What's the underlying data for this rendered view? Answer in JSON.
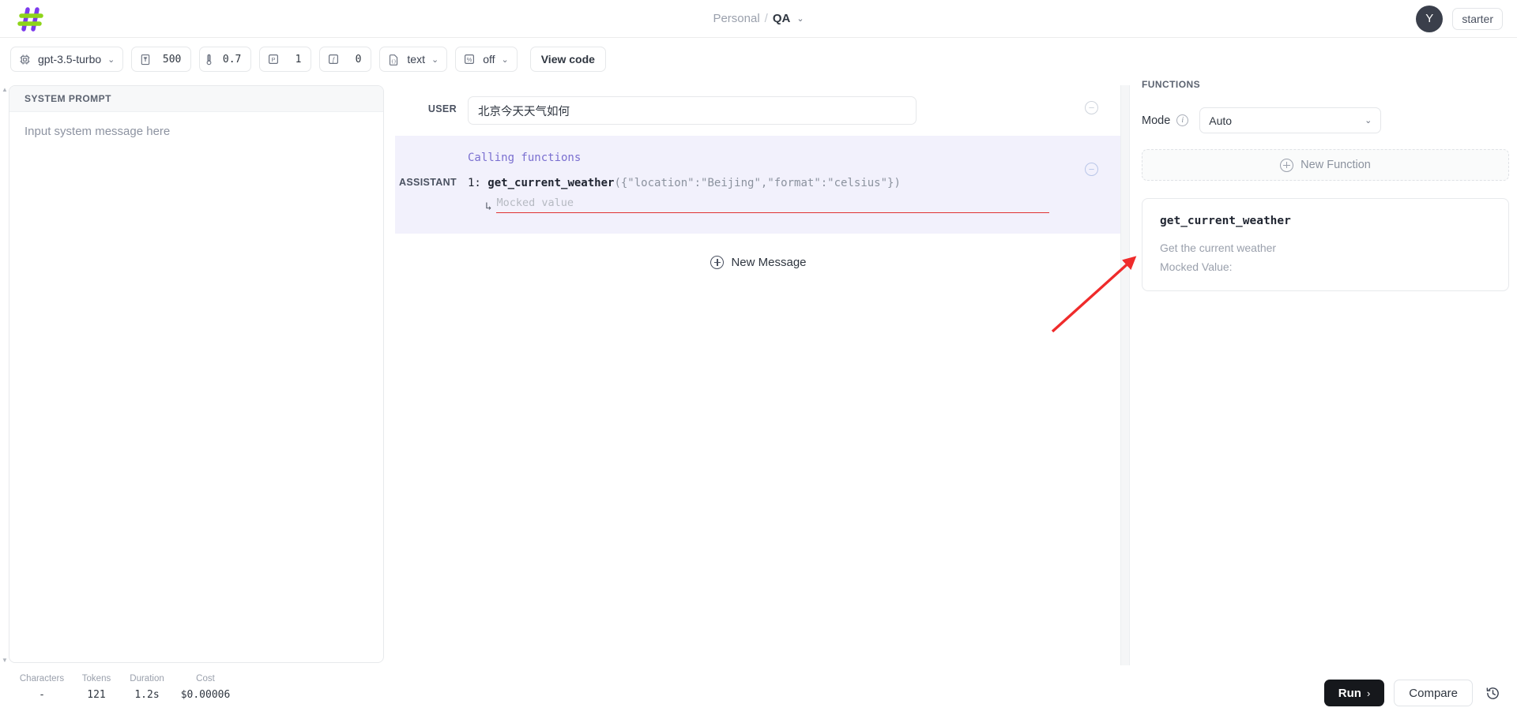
{
  "header": {
    "logo_icon": "hash-logo-icon",
    "breadcrumb": {
      "org": "Personal",
      "separator": "/",
      "project": "QA",
      "caret": "⌄"
    },
    "avatar_initial": "Y",
    "plan_label": "starter"
  },
  "toolbar": {
    "model": {
      "icon": "chip-icon",
      "value": "gpt-3.5-turbo",
      "caret": "⌄"
    },
    "max_tokens": {
      "icon": "max-length-icon",
      "value": "500"
    },
    "temperature": {
      "icon": "thermometer-icon",
      "value": "0.7"
    },
    "top_p": {
      "icon": "p-box-icon",
      "value": "1"
    },
    "frequency_penalty": {
      "icon": "f-box-icon",
      "value": "0"
    },
    "response_format": {
      "icon": "file-code-icon",
      "value": "text",
      "caret": "⌄"
    },
    "presence_penalty": {
      "icon": "percent-box-icon",
      "value": "off",
      "caret": "⌄"
    },
    "view_code_label": "View code"
  },
  "system_prompt": {
    "title": "SYSTEM PROMPT",
    "placeholder": "Input system message here",
    "value": "Input system message here"
  },
  "messages": [
    {
      "role": "USER",
      "text": "北京今天天气如何",
      "collapse_icon": "minus-circle-icon"
    },
    {
      "role": "ASSISTANT",
      "calling_label": "Calling functions",
      "call_index": "1:",
      "call_name": "get_current_weather",
      "call_args": "({\"location\":\"Beijing\",\"format\":\"celsius\"})",
      "mock_arrow": "↳",
      "mock_placeholder": "Mocked value",
      "collapse_icon": "minus-circle-icon"
    }
  ],
  "new_message_label": "New Message",
  "functions_panel": {
    "title": "FUNCTIONS",
    "mode_label": "Mode",
    "info_icon": "info-icon",
    "mode_value": "Auto",
    "mode_caret": "⌄",
    "new_function_label": "New Function",
    "cards": [
      {
        "name": "get_current_weather",
        "description": "Get the current weather",
        "mocked_value_label": "Mocked Value:"
      }
    ]
  },
  "footer": {
    "stats": [
      {
        "label": "Characters",
        "value": "-"
      },
      {
        "label": "Tokens",
        "value": "121"
      },
      {
        "label": "Duration",
        "value": "1.2s"
      },
      {
        "label": "Cost",
        "value": "$0.00006"
      }
    ],
    "run_label": "Run",
    "run_chevron": "›",
    "compare_label": "Compare",
    "history_icon": "history-clock-icon"
  },
  "annotation": {
    "type": "red-arrow",
    "color": "#ef2b2b"
  },
  "colors": {
    "assistant_bg": "#f2f1fc",
    "accent_purple": "#7a6fd0",
    "logo_purple": "#7c3aed",
    "logo_green": "#8ed41a",
    "error_red": "#e03131",
    "run_bg": "#16181c"
  }
}
